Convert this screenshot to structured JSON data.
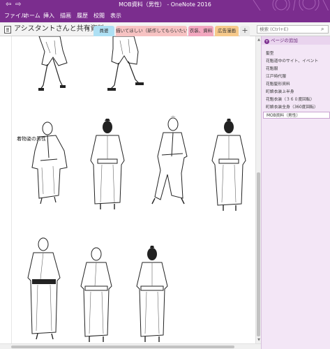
{
  "window": {
    "title": "MOB資料（男性） - OneNote 2016",
    "back_icon": "back-arrow-icon",
    "forward_icon": "forward-arrow-icon"
  },
  "ribbon": {
    "tabs": [
      "ファイル",
      "ホーム",
      "挿入",
      "描画",
      "履歴",
      "校閲",
      "表示"
    ]
  },
  "notebook": {
    "name": "アシスタントさんと共有資料",
    "chevron": "▾"
  },
  "section_tabs": [
    {
      "label": "員婆",
      "color": "#aee0f4"
    },
    {
      "label": "描いてほしい（新作してもらいたいもの）",
      "color": "#f7c3c3"
    },
    {
      "label": "衣装、資料",
      "color": "#f2a7bf"
    },
    {
      "label": "広告漫画",
      "color": "#f6c98b"
    }
  ],
  "section_add_label": "+",
  "search": {
    "placeholder": "検索 (Ctrl+E)"
  },
  "page": {
    "heading": "着物姿の男性"
  },
  "page_list": {
    "add_label": "ページの追加",
    "items": [
      "髪型",
      "花魁道中のサイト、イベント",
      "花魁服",
      "江戸時代服",
      "花魁髪形資料",
      "町娘衣装上半身",
      "花魁衣装（３６０度回転）",
      "町娘衣装全身（360度回転）",
      "MOB資料（男性）"
    ],
    "selected_index": 8
  },
  "colors": {
    "accent": "#7b2d8e",
    "page_list_bg": "#f3e6f6"
  }
}
